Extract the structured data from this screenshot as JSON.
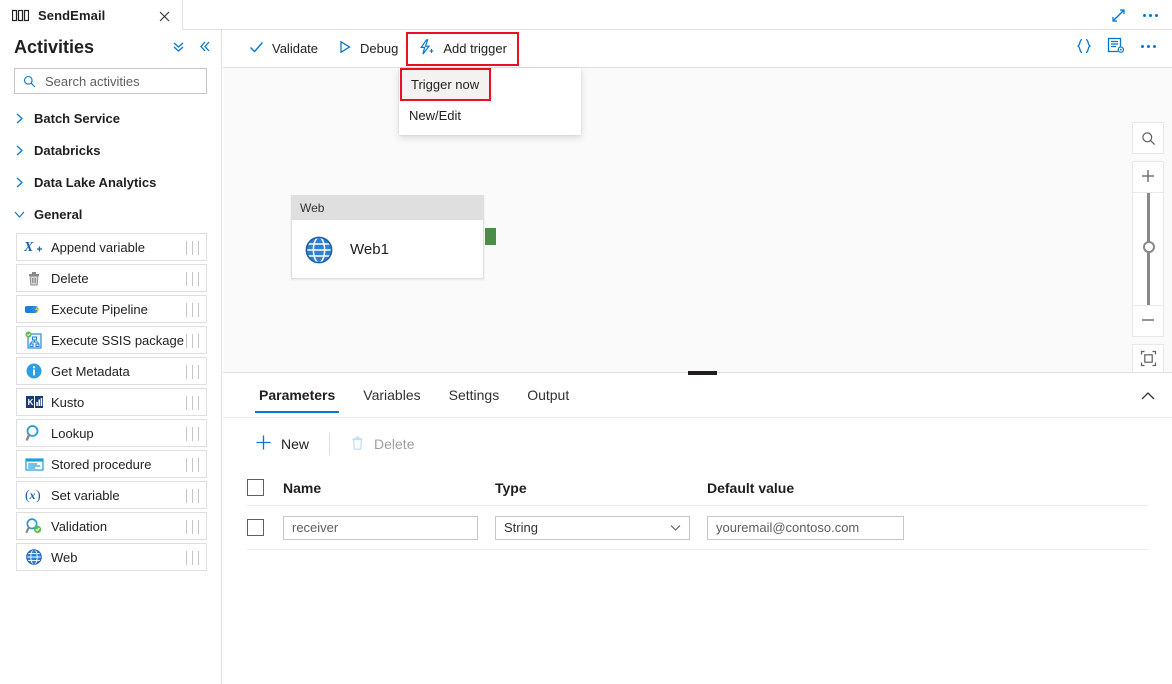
{
  "titlebar": {
    "tab_label": "SendEmail",
    "tab_icon": "pipeline-icon",
    "close_icon": "close-icon",
    "expand_icon": "expand-icon",
    "more_icon": "more-actions-icon"
  },
  "sidebar": {
    "title": "Activities",
    "collapse_all_icon": "double-chevron-down-icon",
    "collapse_pane_icon": "double-chevron-left-icon",
    "search": {
      "placeholder": "Search activities",
      "value": "",
      "icon": "search-icon"
    },
    "groups": [
      {
        "label": "Batch Service",
        "expanded": false
      },
      {
        "label": "Databricks",
        "expanded": false
      },
      {
        "label": "Data Lake Analytics",
        "expanded": false
      },
      {
        "label": "General",
        "expanded": true
      }
    ],
    "activities": [
      {
        "label": "Append variable",
        "icon": "append-variable-icon"
      },
      {
        "label": "Delete",
        "icon": "delete-trash-icon"
      },
      {
        "label": "Execute Pipeline",
        "icon": "execute-pipeline-icon"
      },
      {
        "label": "Execute SSIS package",
        "icon": "execute-ssis-package-icon"
      },
      {
        "label": "Get Metadata",
        "icon": "get-metadata-info-icon"
      },
      {
        "label": "Kusto",
        "icon": "kusto-icon"
      },
      {
        "label": "Lookup",
        "icon": "lookup-magnifier-icon"
      },
      {
        "label": "Stored procedure",
        "icon": "stored-procedure-icon"
      },
      {
        "label": "Set variable",
        "icon": "set-variable-icon"
      },
      {
        "label": "Validation",
        "icon": "validation-icon"
      },
      {
        "label": "Web",
        "icon": "web-globe-icon"
      }
    ]
  },
  "toolbar": {
    "validate_label": "Validate",
    "validate_icon": "checkmark-icon",
    "debug_label": "Debug",
    "debug_icon": "play-triangle-icon",
    "add_trigger_label": "Add trigger",
    "add_trigger_icon": "lightning-bolt-plus-icon",
    "code_icon": "code-braces-icon",
    "properties_icon": "properties-gear-icon",
    "more_icon": "more-actions-icon",
    "highlight_color": "#e81123"
  },
  "trigger_menu": {
    "items": [
      {
        "label": "Trigger now",
        "highlighted": true
      },
      {
        "label": "New/Edit",
        "highlighted": false
      }
    ]
  },
  "canvas": {
    "node": {
      "type_label": "Web",
      "name": "Web1",
      "icon": "web-globe-icon",
      "port_color": "#4c8c4a"
    },
    "zoom_controls": {
      "search_icon": "zoom-search-icon",
      "zoom_in_icon": "plus-icon",
      "zoom_out_icon": "minus-icon",
      "fit_icon": "fit-to-screen-icon"
    }
  },
  "bottom_panel": {
    "tabs": [
      {
        "label": "Parameters",
        "active": true
      },
      {
        "label": "Variables",
        "active": false
      },
      {
        "label": "Settings",
        "active": false
      },
      {
        "label": "Output",
        "active": false
      }
    ],
    "collapse_icon": "chevron-up-icon",
    "actions": {
      "new_label": "New",
      "new_icon": "plus-icon",
      "delete_label": "Delete",
      "delete_icon": "trash-icon",
      "delete_disabled": true
    },
    "table": {
      "columns": [
        "Name",
        "Type",
        "Default value"
      ],
      "rows": [
        {
          "selected": false,
          "name": "receiver",
          "type": "String",
          "default_value": "youremail@contoso.com"
        }
      ]
    }
  }
}
